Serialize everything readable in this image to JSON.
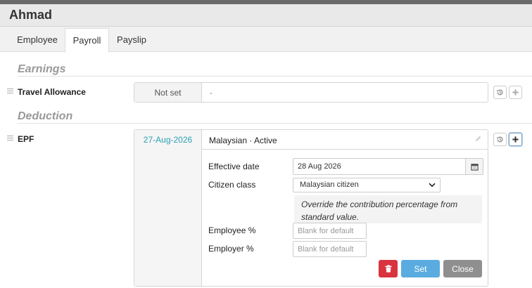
{
  "window": {
    "title": "Ahmad"
  },
  "tabs": [
    {
      "label": "Employee"
    },
    {
      "label": "Payroll"
    },
    {
      "label": "Payslip"
    }
  ],
  "earnings": {
    "title": "Earnings",
    "items": [
      {
        "label": "Travel Allowance",
        "status": "Not set",
        "value": "-"
      }
    ]
  },
  "deduction": {
    "title": "Deduction",
    "items": [
      {
        "label": "EPF",
        "date": "27-Aug-2026",
        "summary": "Malaysian · Active",
        "form": {
          "effective_date_label": "Effective date",
          "effective_date_value": "28 Aug 2026",
          "citizen_class_label": "Citizen class",
          "citizen_class_value": "Malaysian citizen",
          "override_note": "Override the contribution percentage from standard value.",
          "employee_pct_label": "Employee %",
          "employee_pct_placeholder": "Blank for default",
          "employer_pct_label": "Employer %",
          "employer_pct_placeholder": "Blank for default",
          "set_label": "Set",
          "close_label": "Close"
        }
      }
    ]
  },
  "icons": {
    "history": "history-icon",
    "add": "plus-icon",
    "edit": "pencil-icon",
    "calendar": "calendar-icon",
    "delete": "trash-icon",
    "drag": "drag-handle-icon"
  },
  "colors": {
    "date_link": "#2aa0b5",
    "set_button": "#5aace0",
    "close_button": "#8f8f8f",
    "delete_button": "#d9333f"
  }
}
